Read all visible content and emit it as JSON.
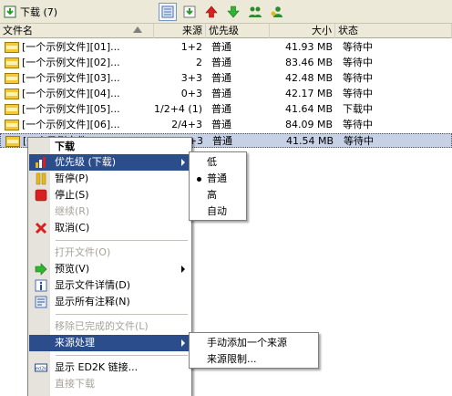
{
  "toolbar": {
    "title": "下载 (7)",
    "icons": [
      "download-list-icon",
      "download-view-icon",
      "priority-up-icon",
      "priority-down-icon",
      "users-icon",
      "user-icon"
    ]
  },
  "columns": [
    "文件名",
    "来源",
    "优先级",
    "大小",
    "状态"
  ],
  "files": [
    {
      "name": "[一个示例文件][01]...",
      "sources": "1+2",
      "priority": "普通",
      "size": "41.93 MB",
      "status": "等待中"
    },
    {
      "name": "[一个示例文件][02]...",
      "sources": "2",
      "priority": "普通",
      "size": "83.46 MB",
      "status": "等待中"
    },
    {
      "name": "[一个示例文件][03]...",
      "sources": "3+3",
      "priority": "普通",
      "size": "42.48 MB",
      "status": "等待中"
    },
    {
      "name": "[一个示例文件][04]...",
      "sources": "0+3",
      "priority": "普通",
      "size": "42.17 MB",
      "status": "等待中"
    },
    {
      "name": "[一个示例文件][05]...",
      "sources": "1/2+4 (1)",
      "priority": "普通",
      "size": "41.64 MB",
      "status": "下载中"
    },
    {
      "name": "[一个示例文件][06]...",
      "sources": "2/4+3",
      "priority": "普通",
      "size": "84.09 MB",
      "status": "等待中"
    },
    {
      "name": "[一个示例文件][07]...",
      "sources": "3+3",
      "priority": "普通",
      "size": "41.54 MB",
      "status": "等待中"
    }
  ],
  "context_menu": {
    "header": "下载",
    "priority": "优先级 (下载)",
    "pause": "暂停(P)",
    "stop": "停止(S)",
    "resume": "继续(R)",
    "cancel": "取消(C)",
    "open_file": "打开文件(O)",
    "preview": "预览(V)",
    "show_details": "显示文件详情(D)",
    "show_comments": "显示所有注释(N)",
    "clear_completed": "移除已完成的文件(L)",
    "source_handling": "来源处理",
    "show_ed2k": "显示 ED2K 链接...",
    "direct_download": "直接下载"
  },
  "priority_submenu": {
    "low": "低",
    "normal": "普通",
    "high": "高",
    "auto": "自动",
    "selected": "普通"
  },
  "source_submenu": {
    "add_manual": "手动添加一个来源",
    "limit": "来源限制..."
  },
  "colors": {
    "highlight": "#2b4d8c",
    "selected_row": "#c7d1e6",
    "disabled": "#a7a39b",
    "toolbar_bg": "#ece9d8"
  }
}
